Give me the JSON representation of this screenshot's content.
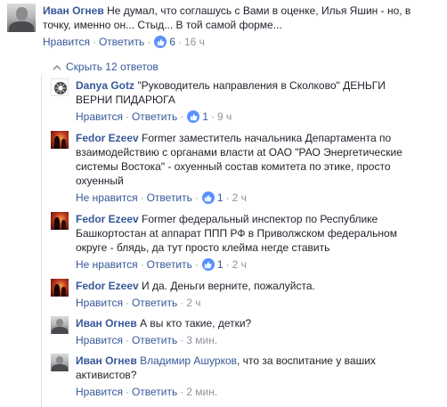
{
  "comments": [
    {
      "author": "Иван Огнев",
      "text_1": "Не думал, что соглашусь с Вами в оценке, Илья Яшин - но, в",
      "text_2": "точку, именно он... Стыд... В той самой форме...",
      "like_label": "Нравится",
      "reply_label": "Ответить",
      "like_count": "6",
      "time": "16 ч"
    },
    {
      "author": "Danya Gotz",
      "text_1": "\"Руководитель направления в Сколково\" ДЕНЬГИ",
      "text_2": "ВЕРНИ ПИДАРЮГА",
      "like_label": "Нравится",
      "reply_label": "Ответить",
      "like_count": "1",
      "time": "9 ч"
    },
    {
      "author": "Fedor Ezeev",
      "text_1": "Former заместитель начальника Департамента по",
      "text_2": "взаимодействию с органами власти at ОАО \"РАО Энергетические",
      "text_3": "системы Востока\" - охуенный состав комитета по этике, просто",
      "text_4": "охуенный",
      "like_label": "Не нравится",
      "reply_label": "Ответить",
      "like_count": "1",
      "time": "2 ч"
    },
    {
      "author": "Fedor Ezeev",
      "text_1": "Former федеральный инспектор по Республике",
      "text_2": "Башкортостан at аппарат ППП РФ в Приволжском федеральном",
      "text_3": "округе - блядь, да тут просто клейма негде ставить",
      "like_label": "Не нравится",
      "reply_label": "Ответить",
      "like_count": "1",
      "time": "2 ч"
    },
    {
      "author": "Fedor Ezeev",
      "text_1": "И да. Деньги верните, пожалуйста.",
      "like_label": "Нравится",
      "reply_label": "Ответить",
      "time": "2 ч"
    },
    {
      "author": "Иван Огнев",
      "text_1": "А вы кто такие, детки?",
      "like_label": "Нравится",
      "reply_label": "Ответить",
      "time": "3 мин."
    },
    {
      "author": "Иван Огнев",
      "mention": "Владимир Ашурков",
      "text_1": ", что за воспитание у ваших",
      "text_2": "активистов?",
      "like_label": "Нравится",
      "reply_label": "Ответить",
      "time": "2 мин."
    }
  ],
  "hide_replies_label": "Скрыть 12 ответов",
  "colors": {
    "link": "#365899",
    "meta": "#90949c",
    "text": "#1d2129",
    "like_badge": "#5890ff"
  }
}
